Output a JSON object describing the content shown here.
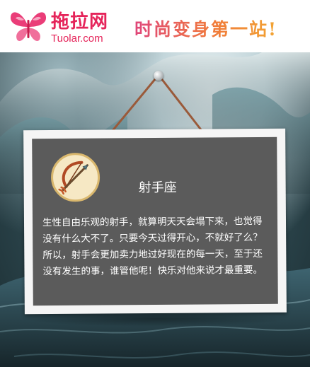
{
  "header": {
    "logo_cn": "拖拉网",
    "logo_en": "Tuolar.com",
    "slogan": "时尚变身第一站!"
  },
  "card": {
    "sign_name": "射手座",
    "description": "生性自由乐观的射手，就算明天天会塌下来，也觉得没有什么大不了。只要今天过得开心，不就好了么？所以，射手会更加卖力地过好现在的每一天，至于还没有发生的事，谁管他呢！快乐对他来说才最重要。"
  },
  "icons": {
    "logo": "butterfly-logo-icon",
    "emblem": "sagittarius-bow-arrow-icon"
  },
  "colors": {
    "brand": "#e5245a",
    "panel": "#5b5b5b",
    "board": "#f5f5f5"
  }
}
